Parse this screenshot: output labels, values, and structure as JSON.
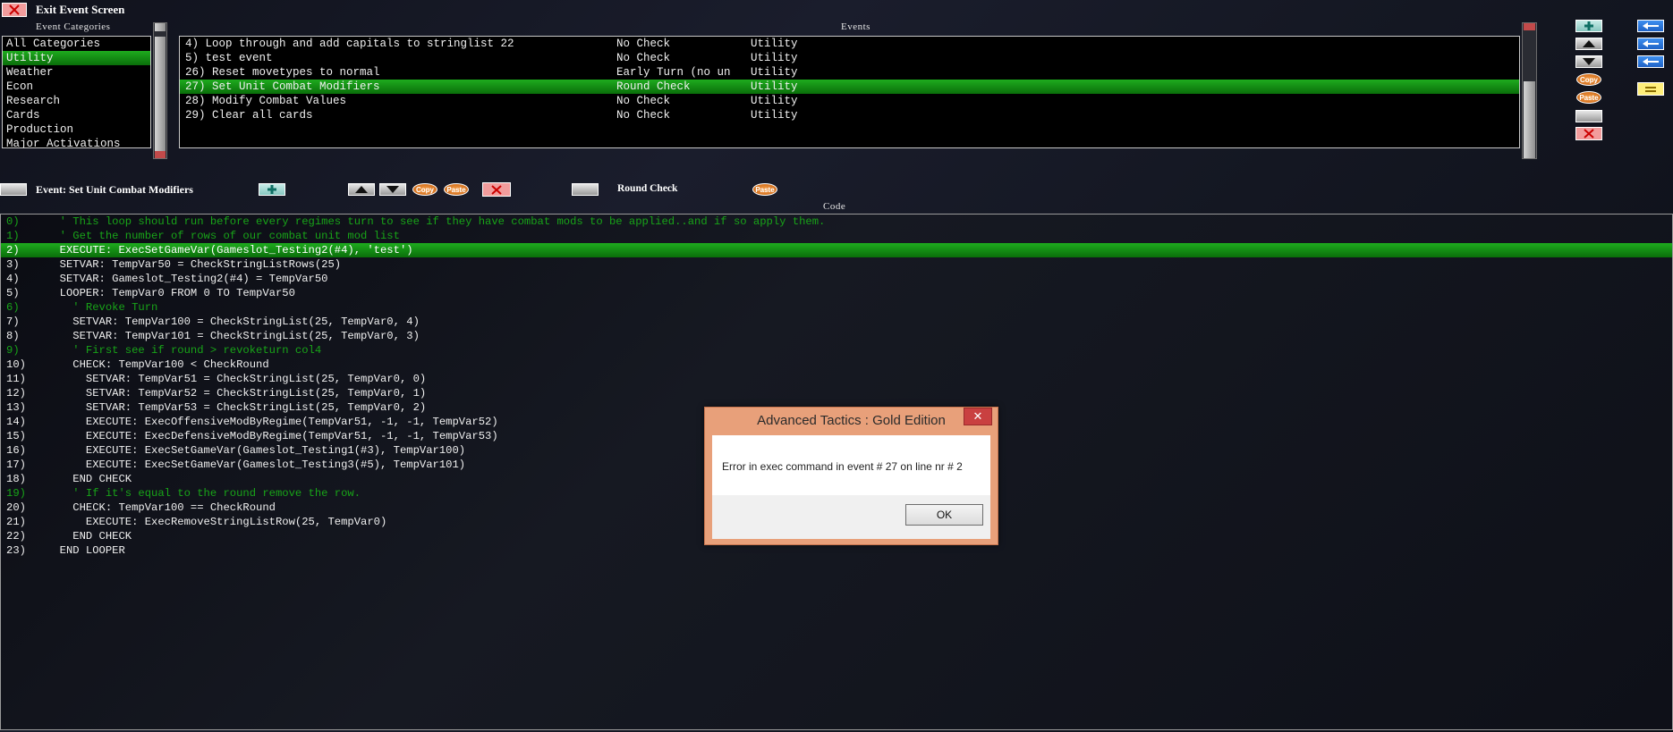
{
  "top": {
    "exit_label": "Exit Event Screen"
  },
  "categories": {
    "title": "Event Categories",
    "items": [
      "All Categories",
      "Utility",
      "Weather",
      "Econ",
      "Research",
      "Cards",
      "Production",
      "Major Activations"
    ],
    "selected_index": 1
  },
  "events": {
    "title": "Events",
    "rows": [
      {
        "name": "4) Loop through and add capitals to stringlist 22",
        "check": "No Check",
        "category": "Utility"
      },
      {
        "name": "5) test event",
        "check": "No Check",
        "category": "Utility"
      },
      {
        "name": "26) Reset movetypes to normal",
        "check": "Early Turn (no un",
        "category": "Utility"
      },
      {
        "name": "27) Set Unit Combat Modifiers",
        "check": "Round Check",
        "category": "Utility"
      },
      {
        "name": "28) Modify Combat Values",
        "check": "No Check",
        "category": "Utility"
      },
      {
        "name": "29) Clear all cards",
        "check": "No Check",
        "category": "Utility"
      }
    ],
    "selected_index": 3
  },
  "side_buttons": {
    "copy_label": "Copy",
    "paste_label": "Paste"
  },
  "editor": {
    "event_label": "Event: Set Unit Combat Modifiers",
    "check_label": "Round Check",
    "code_title": "Code",
    "copy_label": "Copy",
    "paste_label": "Paste"
  },
  "code": {
    "lines": [
      {
        "n": "0)",
        "t": "  ' This loop should run before every regimes turn to see if they have combat mods to be applied..and if so apply them.",
        "type": "comment"
      },
      {
        "n": "1)",
        "t": "  ' Get the number of rows of our combat unit mod list",
        "type": "comment"
      },
      {
        "n": "2)",
        "t": "  EXECUTE: ExecSetGameVar(Gameslot_Testing2(#4), 'test')",
        "type": "selected"
      },
      {
        "n": "3)",
        "t": "  SETVAR: TempVar50 = CheckStringListRows(25)",
        "type": "code"
      },
      {
        "n": "4)",
        "t": "  SETVAR: Gameslot_Testing2(#4) = TempVar50",
        "type": "code"
      },
      {
        "n": "5)",
        "t": "  LOOPER: TempVar0 FROM 0 TO TempVar50",
        "type": "code"
      },
      {
        "n": "6)",
        "t": "    ' Revoke Turn",
        "type": "comment"
      },
      {
        "n": "7)",
        "t": "    SETVAR: TempVar100 = CheckStringList(25, TempVar0, 4)",
        "type": "code"
      },
      {
        "n": "8)",
        "t": "    SETVAR: TempVar101 = CheckStringList(25, TempVar0, 3)",
        "type": "code"
      },
      {
        "n": "9)",
        "t": "    ' First see if round > revoketurn col4",
        "type": "comment"
      },
      {
        "n": "10)",
        "t": "    CHECK: TempVar100 < CheckRound",
        "type": "code"
      },
      {
        "n": "11)",
        "t": "      SETVAR: TempVar51 = CheckStringList(25, TempVar0, 0)",
        "type": "code"
      },
      {
        "n": "12)",
        "t": "      SETVAR: TempVar52 = CheckStringList(25, TempVar0, 1)",
        "type": "code"
      },
      {
        "n": "13)",
        "t": "      SETVAR: TempVar53 = CheckStringList(25, TempVar0, 2)",
        "type": "code"
      },
      {
        "n": "14)",
        "t": "      EXECUTE: ExecOffensiveModByRegime(TempVar51, -1, -1, TempVar52)",
        "type": "code"
      },
      {
        "n": "15)",
        "t": "      EXECUTE: ExecDefensiveModByRegime(TempVar51, -1, -1, TempVar53)",
        "type": "code"
      },
      {
        "n": "16)",
        "t": "      EXECUTE: ExecSetGameVar(Gameslot_Testing1(#3), TempVar100)",
        "type": "code"
      },
      {
        "n": "17)",
        "t": "      EXECUTE: ExecSetGameVar(Gameslot_Testing3(#5), TempVar101)",
        "type": "code"
      },
      {
        "n": "18)",
        "t": "    END CHECK",
        "type": "code"
      },
      {
        "n": "19)",
        "t": "    ' If it's equal to the round remove the row.",
        "type": "comment"
      },
      {
        "n": "20)",
        "t": "    CHECK: TempVar100 == CheckRound",
        "type": "code"
      },
      {
        "n": "21)",
        "t": "      EXECUTE: ExecRemoveStringListRow(25, TempVar0)",
        "type": "code"
      },
      {
        "n": "22)",
        "t": "    END CHECK",
        "type": "code"
      },
      {
        "n": "23)",
        "t": "  END LOOPER",
        "type": "code"
      }
    ]
  },
  "dialog": {
    "title": "Advanced Tactics : Gold Edition",
    "message": "Error in exec command in event # 27 on line nr # 2",
    "ok_label": "OK"
  }
}
